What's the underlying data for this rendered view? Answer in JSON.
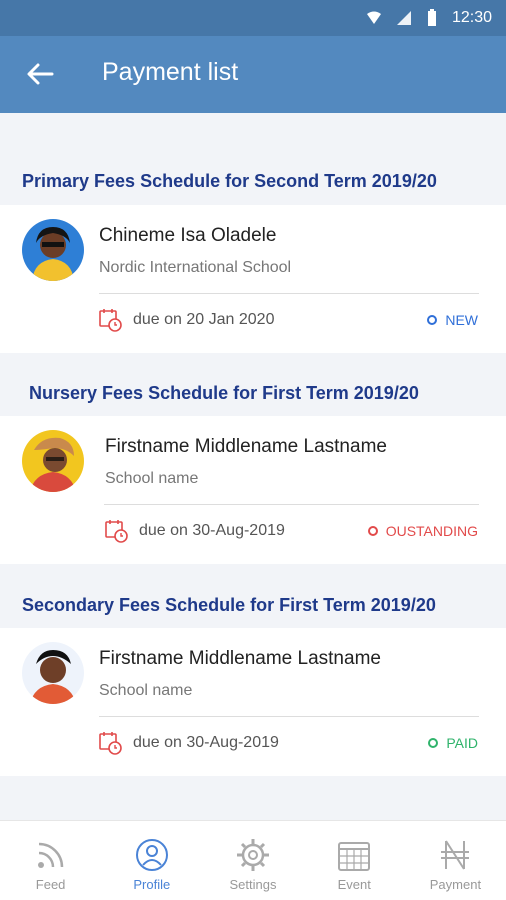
{
  "statusbar": {
    "time": "12:30"
  },
  "header": {
    "title": "Payment list"
  },
  "sections": [
    {
      "title": "Primary Fees Schedule for Second Term 2019/20",
      "name": "Chineme Isa Oladele",
      "school": "Nordic International School",
      "due": "due on 20 Jan 2020",
      "status": "NEW",
      "status_color": "#2f6fd8"
    },
    {
      "title": "Nursery Fees Schedule for First Term 2019/20",
      "name": "Firstname Middlename Lastname",
      "school": "School name",
      "due": "due on 30-Aug-2019",
      "status": "OUSTANDING",
      "status_color": "#e24a4a"
    },
    {
      "title": "Secondary Fees Schedule for First Term 2019/20",
      "name": "Firstname Middlename Lastname",
      "school": "School name",
      "due": "due on 30-Aug-2019",
      "status": "PAID",
      "status_color": "#2fb36b"
    }
  ],
  "tabs": [
    {
      "label": "Feed"
    },
    {
      "label": "Profile"
    },
    {
      "label": "Settings"
    },
    {
      "label": "Event"
    },
    {
      "label": "Payment"
    }
  ]
}
